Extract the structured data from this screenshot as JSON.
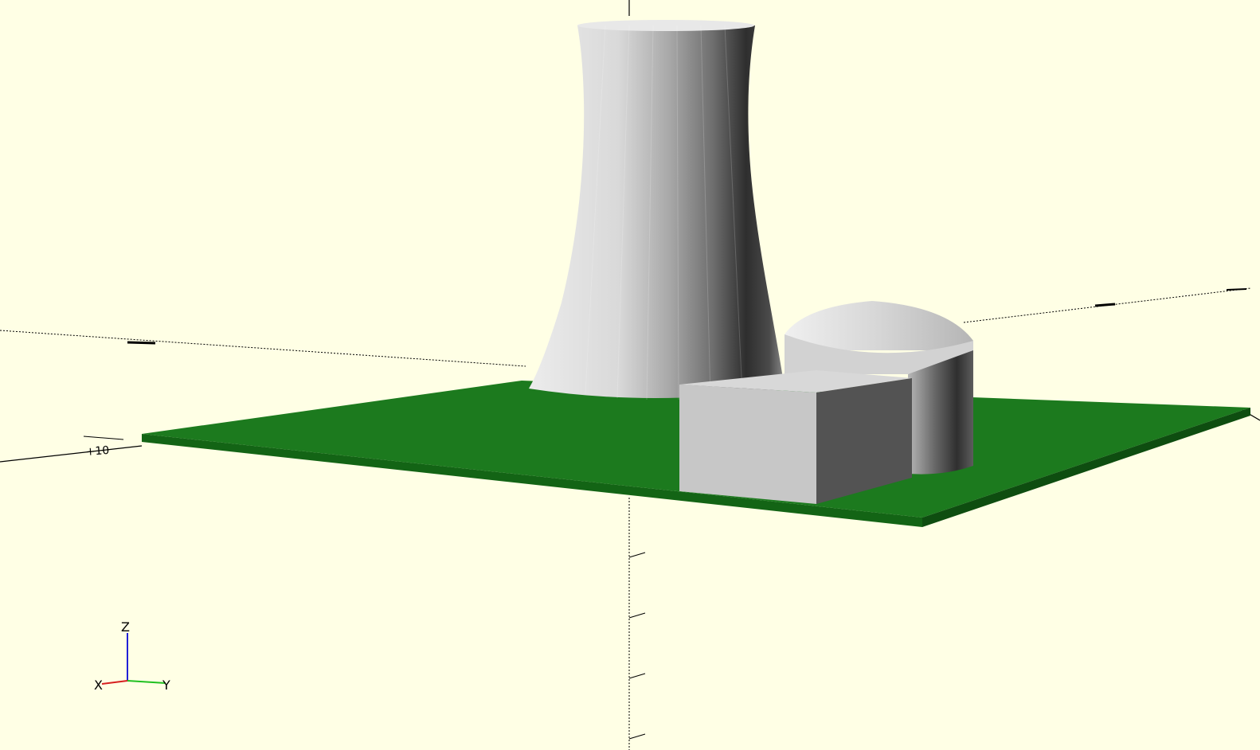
{
  "viewport": {
    "background": "#ffffe5",
    "plate_color": "#1c7a1e",
    "model_color": "#c8c8c8"
  },
  "axes_gizmo": {
    "x_label": "X",
    "y_label": "Y",
    "z_label": "Z",
    "x_color": "#d62020",
    "y_color": "#20c020",
    "z_color": "#2020d6"
  },
  "scale_label": "+10"
}
